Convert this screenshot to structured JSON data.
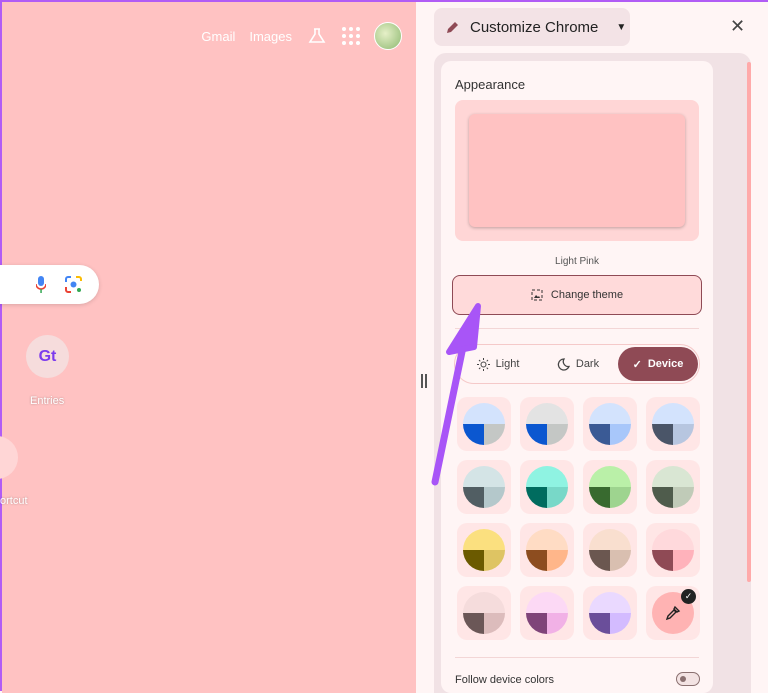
{
  "ntp": {
    "links": [
      "Gmail",
      "Images"
    ],
    "shortcuts": [
      {
        "label": "Entries",
        "glyph": "Gt"
      },
      {
        "label": "ortcut"
      }
    ]
  },
  "panel": {
    "header": "Customize Chrome",
    "section_title": "Appearance",
    "theme_name": "Light Pink",
    "change_theme": "Change theme",
    "modes": [
      {
        "label": "Light",
        "icon": "sun-icon"
      },
      {
        "label": "Dark",
        "icon": "moon-icon"
      },
      {
        "label": "Device",
        "icon": "check-icon",
        "selected": true
      }
    ],
    "swatches": [
      [
        "#d3e3fd",
        "#0b57d0",
        "#c4c7c5"
      ],
      [
        "#e3e3e3",
        "#0b57d0",
        "#c4c7c5"
      ],
      [
        "#d3e3fd",
        "#3a5a95",
        "#a8c7fa"
      ],
      [
        "#d3e3fd",
        "#4a5568",
        "#b7c6e0"
      ],
      [
        "#d4e4e6",
        "#515e63",
        "#b4c8cb"
      ],
      [
        "#8ff3e2",
        "#006c5f",
        "#78d8c8"
      ],
      [
        "#baf0a8",
        "#386a2f",
        "#9ed48f"
      ],
      [
        "#d9e6d3",
        "#4f5c4c",
        "#c0cbb8"
      ],
      [
        "#fbe07f",
        "#6b5a00",
        "#dec463"
      ],
      [
        "#ffdcc4",
        "#8d4d1f",
        "#ffb68a"
      ],
      [
        "#f9dfcf",
        "#6b5750",
        "#d9bfb0"
      ],
      [
        "#ffd9dc",
        "#8f4a55",
        "#ffb2bb"
      ],
      [
        "#f5dcdc",
        "#6b5757",
        "#dcbcbc"
      ],
      [
        "#fcd9f5",
        "#7f4479",
        "#f1b1e6"
      ],
      [
        "#ead9ff",
        "#6a4e9a",
        "#d3bbff"
      ]
    ],
    "custom_color": "#ffb3b3",
    "follow_device": "Follow device colors",
    "follow_device_on": false
  },
  "colors": {
    "accent": "#8f4a55",
    "page_bg": "#ffc2c2",
    "arrow": "#a855f7"
  }
}
